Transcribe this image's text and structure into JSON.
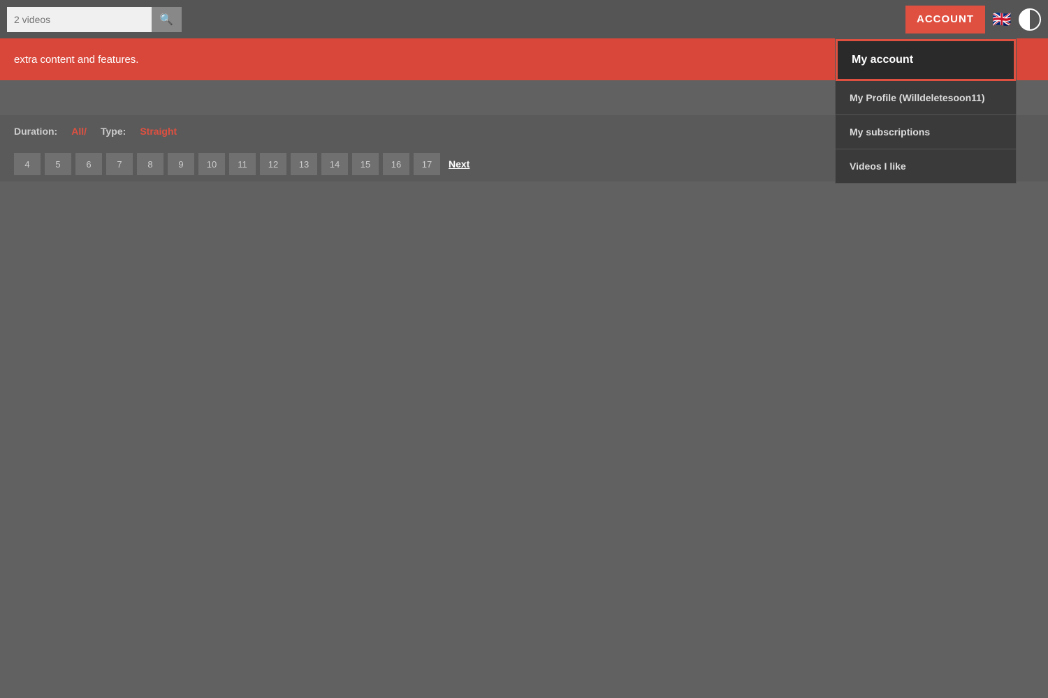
{
  "header": {
    "search_placeholder": "2 videos",
    "account_btn_label": "ACCOUNT",
    "flag_emoji": "🇬🇧",
    "search_icon": "🔍"
  },
  "banner": {
    "text": "extra content and features."
  },
  "filter": {
    "duration_label": "Duration:",
    "duration_value": "All/",
    "type_label": "Type:",
    "type_value": "Straight"
  },
  "pagination": {
    "pages": [
      "4",
      "5",
      "6",
      "7",
      "8",
      "9",
      "10",
      "11",
      "12",
      "13",
      "14",
      "15",
      "16",
      "17"
    ],
    "next_label": "Next"
  },
  "dropdown": {
    "my_account": "My account",
    "my_profile": "My Profile (Willdeletesoon11)",
    "my_subscriptions": "My subscriptions",
    "videos_i_like": "Videos I like"
  }
}
